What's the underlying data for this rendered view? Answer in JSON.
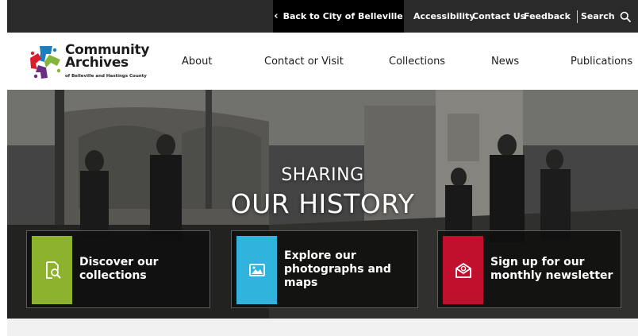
{
  "utility_bar": {
    "back_label": "Back to City of Belleville",
    "links": [
      "Accessibility",
      "Contact Us",
      "Feedback"
    ],
    "search_label": "Search"
  },
  "logo": {
    "line1": "Community",
    "line2": "Archives",
    "subline": "of Belleville and Hastings County"
  },
  "nav": {
    "items": [
      "About",
      "Contact or Visit",
      "Collections",
      "News",
      "Publications"
    ]
  },
  "hero": {
    "line1": "SHARING",
    "line2": "OUR HISTORY"
  },
  "cards": [
    {
      "label_lines": [
        "Discover our",
        "collections"
      ],
      "icon": "document-search-icon",
      "color": "#8cb22e"
    },
    {
      "label_lines": [
        "Explore our",
        "photographs and",
        "maps"
      ],
      "icon": "image-icon",
      "color": "#30b4dd"
    },
    {
      "label_lines": [
        "Sign up for our",
        "monthly newsletter"
      ],
      "icon": "email-icon",
      "color": "#c0102e"
    }
  ],
  "colors": {
    "utility_bar": "#2a2a2a",
    "back_button": "#000000",
    "logo_red": "#d71f2e",
    "logo_blue": "#1b7ec2",
    "logo_green": "#86b53c",
    "logo_purple": "#6a2d83"
  }
}
